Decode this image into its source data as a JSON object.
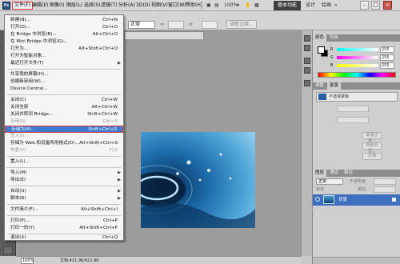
{
  "app": {
    "logo": "Ps"
  },
  "menubar": {
    "items": [
      {
        "label": "文件(F)"
      },
      {
        "label": "编辑(E)"
      },
      {
        "label": "图像(I)"
      },
      {
        "label": "图层(L)"
      },
      {
        "label": "选择(S)"
      },
      {
        "label": "滤镜(T)"
      },
      {
        "label": "分析(A)"
      },
      {
        "label": "3D(D)"
      },
      {
        "label": "视图(V)"
      },
      {
        "label": "窗口(W)"
      },
      {
        "label": "帮助(H)"
      }
    ],
    "zoom": "100%",
    "workspace_active": "基本功能",
    "workspace_links": [
      "设计",
      "绘画"
    ]
  },
  "options_bar": {
    "mode_value": "正常",
    "refine_edge": "调整边缘..."
  },
  "file_menu": {
    "items": [
      {
        "label": "新建(N)...",
        "shortcut": "Ctrl+N"
      },
      {
        "label": "打开(O)...",
        "shortcut": "Ctrl+O"
      },
      {
        "label": "在 Bridge 中浏览(B)...",
        "shortcut": "Alt+Ctrl+O"
      },
      {
        "label": "在 Mini Bridge 中浏览(G)...",
        "shortcut": ""
      },
      {
        "label": "打开为...",
        "shortcut": "Alt+Shift+Ctrl+O"
      },
      {
        "label": "打开为智能对象...",
        "shortcut": ""
      },
      {
        "label": "最近打开文件(T)",
        "shortcut": ""
      },
      {
        "label": "共享我的屏幕(H)...",
        "shortcut": ""
      },
      {
        "label": "创建新审阅(W)...",
        "shortcut": ""
      },
      {
        "label": "Device Central...",
        "shortcut": ""
      },
      {
        "label": "关闭(C)",
        "shortcut": "Ctrl+W"
      },
      {
        "label": "关闭全部",
        "shortcut": "Alt+Ctrl+W"
      },
      {
        "label": "关闭并转到 Bridge...",
        "shortcut": "Shift+Ctrl+W"
      },
      {
        "label": "存储(S)",
        "shortcut": "Ctrl+S"
      },
      {
        "label": "存储为(A)...",
        "shortcut": "Shift+Ctrl+S"
      },
      {
        "label": "签入(I)...",
        "shortcut": ""
      },
      {
        "label": "存储为 Web 和设备所用格式(D)...",
        "shortcut": "Alt+Shift+Ctrl+S"
      },
      {
        "label": "恢复(V)",
        "shortcut": "F12"
      },
      {
        "label": "置入(L)...",
        "shortcut": ""
      },
      {
        "label": "导入(M)",
        "shortcut": ""
      },
      {
        "label": "导出(E)",
        "shortcut": ""
      },
      {
        "label": "自动(U)",
        "shortcut": ""
      },
      {
        "label": "脚本(R)",
        "shortcut": ""
      },
      {
        "label": "文件简介(F)...",
        "shortcut": "Alt+Shift+Ctrl+I"
      },
      {
        "label": "打印(P)...",
        "shortcut": "Ctrl+P"
      },
      {
        "label": "打印一份(Y)",
        "shortcut": "Alt+Shift+Ctrl+P"
      },
      {
        "label": "退出(X)",
        "shortcut": "Ctrl+Q"
      }
    ]
  },
  "status_bar": {
    "zoom": "100%",
    "doc_info": "文档:421.9K/421.9K"
  },
  "color_panel": {
    "tabs": [
      "颜色",
      "色板"
    ],
    "channels": [
      {
        "name": "R",
        "value": "255",
        "color": "#e06060"
      },
      {
        "name": "G",
        "value": "255",
        "color": "#5fc45f"
      },
      {
        "name": "B",
        "value": "255",
        "color": "#6a7be8"
      }
    ]
  },
  "adjust_panel": {
    "tabs": [
      "调整",
      "蒙版"
    ],
    "preset": "不选择蒙版",
    "buttons": [
      "蒙版边缘...",
      "颜色范围...",
      "反相"
    ]
  },
  "layers_panel": {
    "tabs": [
      "图层",
      "通道",
      "路径"
    ],
    "blend_mode": "正常",
    "opacity_label": "不透明度:",
    "fill_label": "填充:",
    "lock_label": "锁定:",
    "layers": [
      {
        "name": "背景"
      }
    ]
  }
}
